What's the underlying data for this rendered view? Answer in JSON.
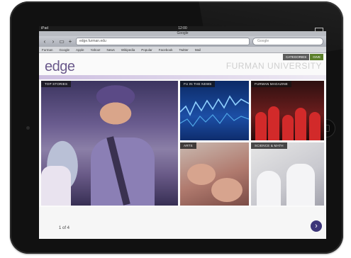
{
  "device": {
    "type": "iPad"
  },
  "status_bar": {
    "carrier": "iPad",
    "time": "12:00"
  },
  "browser": {
    "title": "Google",
    "url": "edge.furman.edu",
    "search_placeholder": "Google",
    "bookmarks": [
      "Furman",
      "Google",
      "Apple",
      "Yahoo!",
      "News",
      "Wikipedia",
      "Popular",
      "Facebook",
      "Twitter",
      "Mail"
    ]
  },
  "site": {
    "logo": "edge",
    "university": "FURMAN UNIVERSITY",
    "nav": {
      "categories": "CATEGORIES",
      "give": "GIVE"
    },
    "tiles": {
      "top_stories": "TOP STORIES",
      "fu_in_the_news": "FU IN THE NEWS",
      "furman_magazine": "FURMAN MAGAZINE",
      "arts": "ARTS",
      "science": "SCIENCE & MATH"
    },
    "page_count": "1 of 4"
  },
  "colors": {
    "brand_purple": "#6b5a8c",
    "next_button": "#3d3679",
    "give_green": "#5b7f2a"
  }
}
